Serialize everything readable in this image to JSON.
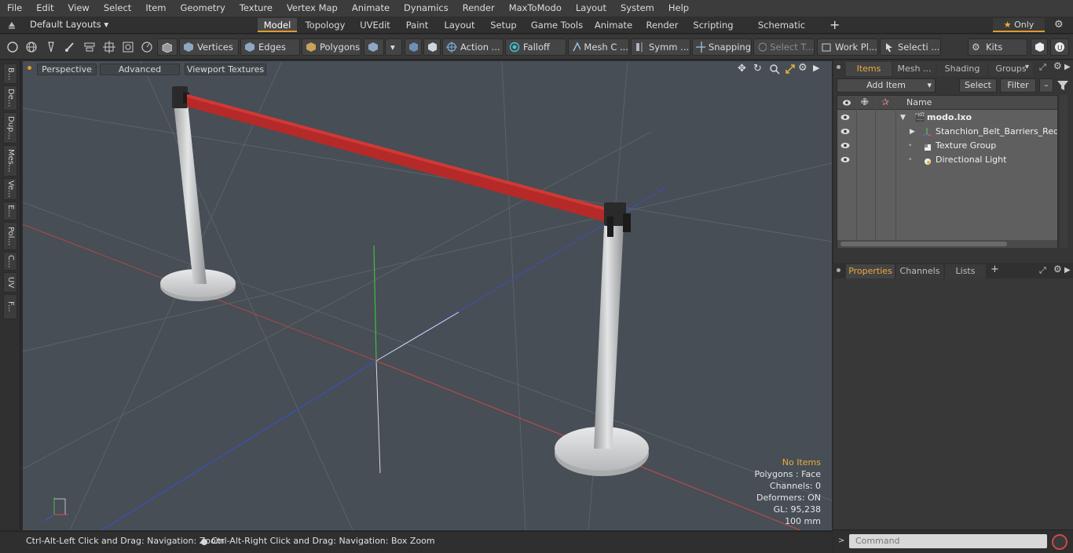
{
  "menu": [
    "File",
    "Edit",
    "View",
    "Select",
    "Item",
    "Geometry",
    "Texture",
    "Vertex Map",
    "Animate",
    "Dynamics",
    "Render",
    "MaxToModo",
    "Layout",
    "System",
    "Help"
  ],
  "layout": {
    "preset": "Default Layouts",
    "tabs": [
      "Model",
      "Topology",
      "UVEdit",
      "Paint",
      "Layout",
      "Setup",
      "Game Tools",
      "Animate",
      "Render",
      "Scripting",
      "Schematic Fusion"
    ],
    "active_tab": "Model",
    "only_label": "Only"
  },
  "toolbar": {
    "vertices": "Vertices",
    "edges": "Edges",
    "polygons": "Polygons",
    "action": "Action ...",
    "falloff": "Falloff",
    "mesh": "Mesh C ...",
    "symm": "Symm ...",
    "snapping": "Snapping",
    "select_t": "Select T...",
    "work_pl": "Work Pl...",
    "selecti": "Selecti ...",
    "kits": "Kits"
  },
  "left_tabs": [
    "B...",
    "De...",
    "Dup...",
    "Mes...",
    "Ve...",
    "E...",
    "Pol...",
    "C...",
    "UV",
    "F..."
  ],
  "viewport": {
    "perspective": "Perspective",
    "advanced": "Advanced",
    "viewport_textures": "Viewport Textures",
    "stats": {
      "no_items": "No Items",
      "polygons": "Polygons : Face",
      "channels": "Channels: 0",
      "deformers": "Deformers: ON",
      "gl": "GL: 95,238",
      "scale": "100 mm"
    }
  },
  "status": {
    "left": "Ctrl-Alt-Left Click and Drag: Navigation: Zoom",
    "right": "Ctrl-Alt-Right Click and Drag: Navigation: Box Zoom"
  },
  "items_panel": {
    "tabs": [
      "Items",
      "Mesh ...",
      "Shading",
      "Groups"
    ],
    "add_item": "Add Item",
    "select": "Select",
    "filter": "Filter",
    "col_name": "Name",
    "rows": [
      {
        "label": "modo.lxo"
      },
      {
        "label": "Stanchion_Belt_Barriers_Red ..."
      },
      {
        "label": "Texture Group"
      },
      {
        "label": "Directional Light"
      }
    ]
  },
  "props_panel": {
    "tabs": [
      "Properties",
      "Channels",
      "Lists"
    ],
    "command_placeholder": "Command"
  },
  "colors": {
    "accent": "#e19a2c",
    "belt": "#b52a28",
    "viewport_bg": "#474e55"
  }
}
